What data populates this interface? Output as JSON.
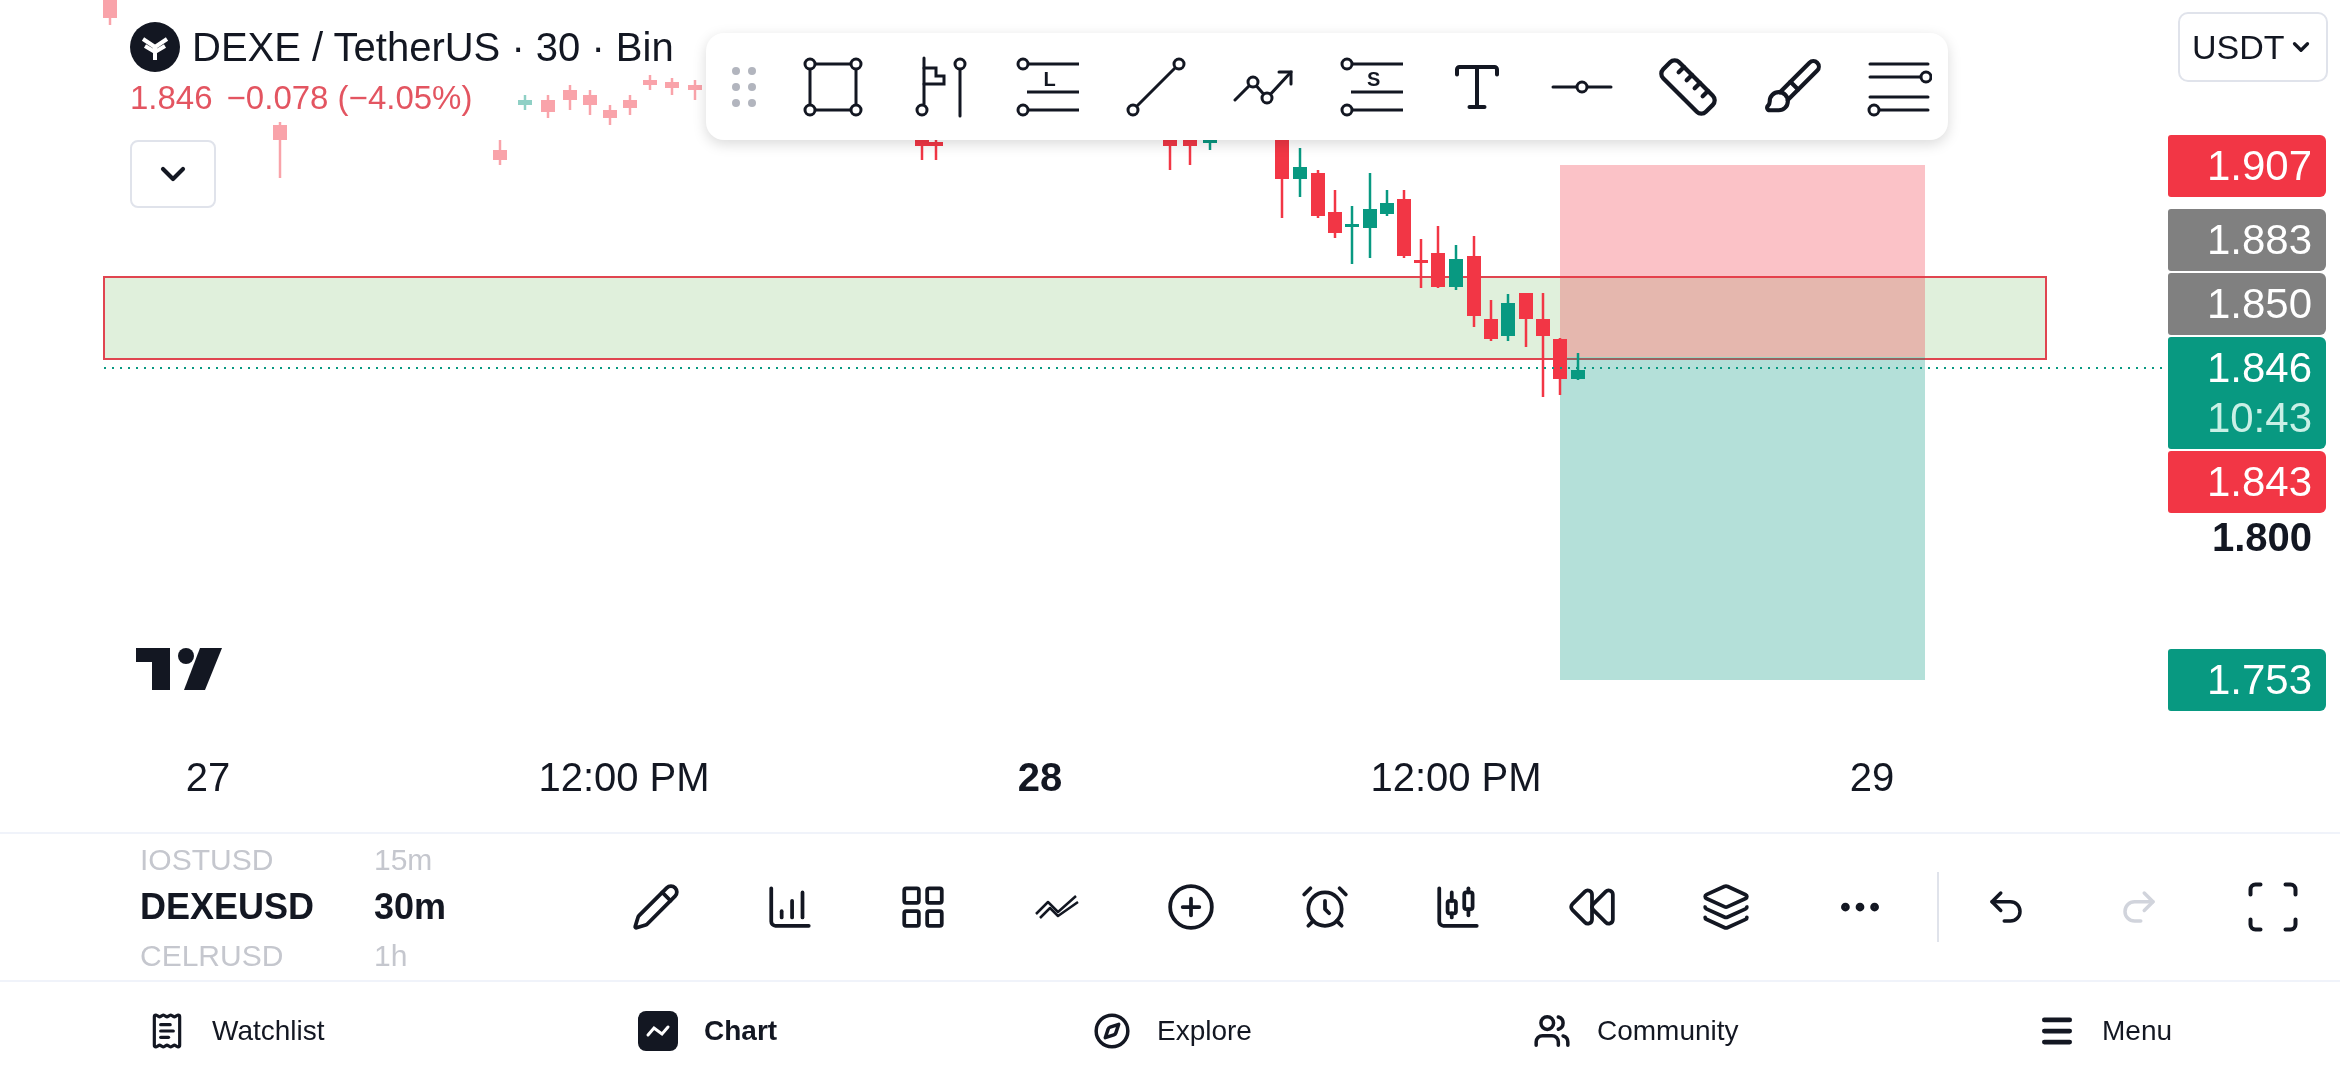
{
  "header": {
    "title": "DEXE / TetherUS · 30 · Bin",
    "price": "1.846",
    "change": "−0.078 (−4.05%)"
  },
  "currency_select": {
    "value": "USDT"
  },
  "drawing_toolbar": {
    "position_tools": [
      {
        "label": "L"
      },
      {
        "label": "S"
      }
    ]
  },
  "price_axis": {
    "labels": [
      {
        "kind": "badge",
        "text": "1.907",
        "color": "#f23645"
      },
      {
        "kind": "badge",
        "text": "1.883",
        "color": "#808080"
      },
      {
        "kind": "badge",
        "text": "1.850",
        "color": "#808080"
      },
      {
        "kind": "badge",
        "text": "1.846",
        "countdown": "10:43",
        "color": "#089981"
      },
      {
        "kind": "badge",
        "text": "1.843",
        "color": "#f23645"
      },
      {
        "kind": "tick",
        "text": "1.800"
      },
      {
        "kind": "badge",
        "text": "1.753",
        "color": "#089981"
      }
    ]
  },
  "time_axis": [
    {
      "text": "27",
      "bold": false
    },
    {
      "text": "12:00 PM",
      "bold": false
    },
    {
      "text": "28",
      "bold": true
    },
    {
      "text": "12:00 PM",
      "bold": false
    },
    {
      "text": "29",
      "bold": false
    }
  ],
  "symbols": [
    {
      "symbol": "IOSTUSD",
      "interval": "15m",
      "selected": false
    },
    {
      "symbol": "DEXEUSD",
      "interval": "30m",
      "selected": true
    },
    {
      "symbol": "CELRUSD",
      "interval": "1h",
      "selected": false
    }
  ],
  "bottom_toolbar": {
    "redo": {
      "disabled": true
    }
  },
  "nav": [
    {
      "label": "Watchlist",
      "selected": false
    },
    {
      "label": "Chart",
      "selected": true
    },
    {
      "label": "Explore",
      "selected": false
    },
    {
      "label": "Community",
      "selected": false
    },
    {
      "label": "Menu",
      "selected": false
    }
  ]
}
